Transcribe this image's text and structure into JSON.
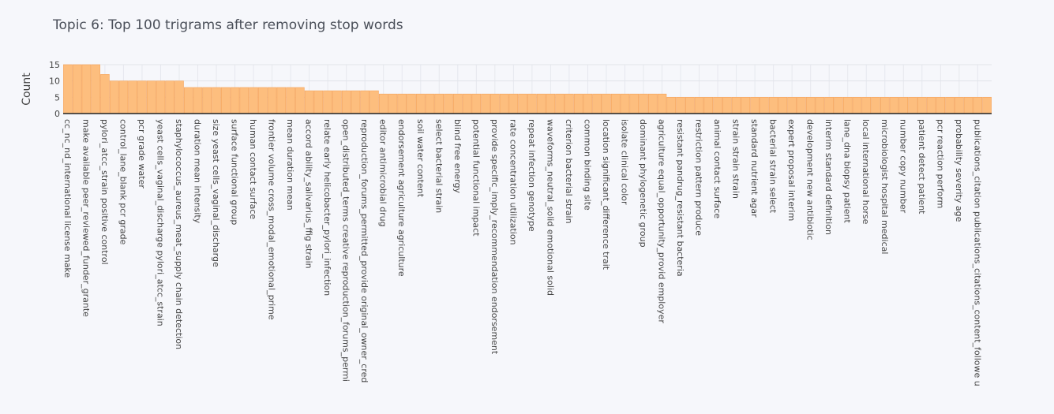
{
  "chart_data": {
    "type": "bar",
    "title": "Topic 6: Top 100 trigrams after removing stop words",
    "xlabel": "",
    "ylabel": "Count",
    "ylim": [
      0,
      15
    ],
    "yticks": [
      0,
      5,
      10,
      15
    ],
    "grid": true,
    "bar_color": "#fdbe7e",
    "bar_edge_color": "#f5a35a",
    "categories": [
      "cc_nc_nd_international license make",
      "",
      "make available peer_reviewed_funder_grante",
      "",
      "pylori_atcc_strain positive control",
      "",
      "control_lane_blank pcr grade",
      "",
      "pcr grade water",
      "",
      "yeast cells_vaginal_discharge pylori_atcc_strain",
      "",
      "staphylococcus_aureus_meat_supply chain detection",
      "",
      "duration mean intensity",
      "",
      "size yeast cells_vaginal_discharge",
      "",
      "surface functional group",
      "",
      "human contact surface",
      "",
      "frontier volume cross_modal_emotional_prime",
      "",
      "mean duration mean",
      "",
      "accord ability_salivarius_ffig strain",
      "",
      "relate early helicobacter_pylori_infection",
      "",
      "open_distributed_terms creative reproduction_forums_permi",
      "",
      "reproduction_forums_permitted_provide original_owner_cred",
      "",
      "editor antimicrobial drug",
      "",
      "endorsement agriculture agriculture",
      "",
      "soil water content",
      "",
      "select bacterial strain",
      "",
      "blind free energy",
      "",
      "potential functional impact",
      "",
      "provide specific_imply_recommendation endorsement",
      "",
      "rate concentration utilization",
      "",
      "repeat infection genotype",
      "",
      "waveforms_neutral_solid emotional solid",
      "",
      "criterion bacterial strain",
      "",
      "common binding site",
      "",
      "location significant_difference trait",
      "",
      "isolate clinical color",
      "",
      "dominant phylogenetic group",
      "",
      "agriculture equal_opportunity_provid employer",
      "",
      "resistant pandrug_resistant bacteria",
      "",
      "restriction pattern produce",
      "",
      "animal contact surface",
      "",
      "strain strain strain",
      "",
      "standard nutrient agar",
      "",
      "bacterial strain select",
      "",
      "expert proposal interim",
      "",
      "development new antibiotic",
      "",
      "interim standard definition",
      "",
      "lane_dna biopsy patient",
      "",
      "local international horse",
      "",
      "microbiologist hospital medical",
      "",
      "number copy number",
      "",
      "patient detect patient",
      "",
      "pcr reaction perform",
      "",
      "probability severity age",
      "",
      "publications_citation publications_citations_content_followe u",
      ""
    ],
    "values": [
      15,
      15,
      15,
      15,
      12,
      10,
      10,
      10,
      10,
      10,
      10,
      10,
      10,
      8,
      8,
      8,
      8,
      8,
      8,
      8,
      8,
      8,
      8,
      8,
      8,
      8,
      7,
      7,
      7,
      7,
      7,
      7,
      7,
      7,
      6,
      6,
      6,
      6,
      6,
      6,
      6,
      6,
      6,
      6,
      6,
      6,
      6,
      6,
      6,
      6,
      6,
      6,
      6,
      6,
      6,
      6,
      6,
      6,
      6,
      6,
      6,
      6,
      6,
      6,
      6,
      5,
      5,
      5,
      5,
      5,
      5,
      5,
      5,
      5,
      5,
      5,
      5,
      5,
      5,
      5,
      5,
      5,
      5,
      5,
      5,
      5,
      5,
      5,
      5,
      5,
      5,
      5,
      5,
      5,
      5,
      5,
      5,
      5,
      5,
      5
    ]
  }
}
